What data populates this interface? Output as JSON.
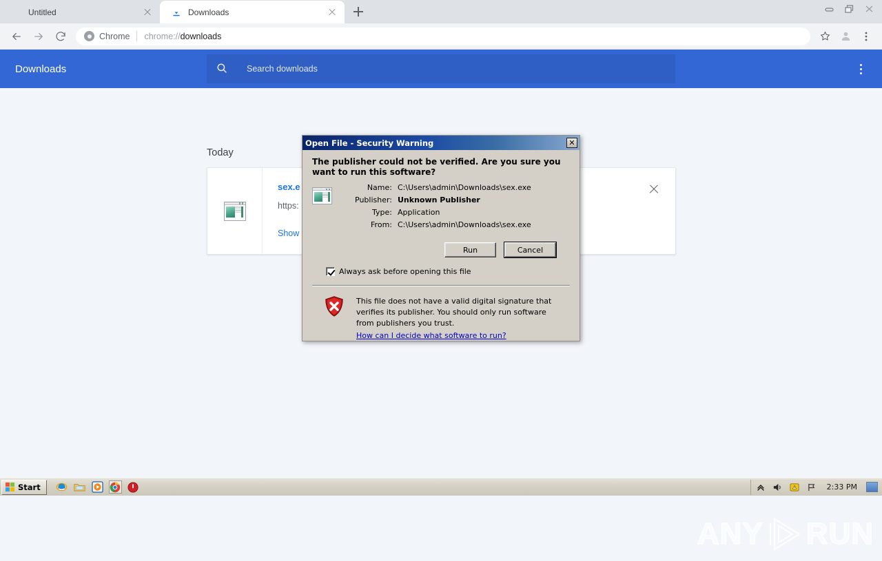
{
  "window_controls": [
    {
      "name": "minimize",
      "glyph": "minimize-icon"
    },
    {
      "name": "restore",
      "glyph": "restore-icon"
    },
    {
      "name": "close",
      "glyph": "close-icon"
    }
  ],
  "tabs": [
    {
      "title": "Untitled",
      "active": false,
      "favicon": "blank-page-icon"
    },
    {
      "title": "Downloads",
      "active": true,
      "favicon": "download-icon"
    }
  ],
  "new_tab_label": "+",
  "toolbar": {
    "back_label": "Back",
    "forward_label": "Forward",
    "reload_label": "Reload",
    "omnibox": {
      "scheme_label": "Chrome",
      "url_prefix": "chrome://",
      "url_main": "downloads",
      "full_url": "chrome://downloads"
    },
    "bookmark_label": "Bookmark this page",
    "profile_label": "Profile",
    "menu_label": "Customize and control Google Chrome"
  },
  "downloads_page": {
    "title": "Downloads",
    "search_placeholder": "Search downloads",
    "menu_label": "More actions",
    "section_label": "Today",
    "item": {
      "filename": "sex.e",
      "url": "https:",
      "action_link": "Show",
      "close_label": "Remove from list",
      "file_icon": "application-window-icon"
    },
    "accent_color": "#3367d6",
    "search_bg_color": "#2f5fc4",
    "link_color": "#1a73e8"
  },
  "dialog": {
    "title": "Open File - Security Warning",
    "close_glyph": "✕",
    "question": "The publisher could not be verified.  Are you sure you want to run this software?",
    "fields": [
      {
        "label": "Name:",
        "value": "C:\\Users\\admin\\Downloads\\sex.exe",
        "bold": false
      },
      {
        "label": "Publisher:",
        "value": "Unknown Publisher",
        "bold": true
      },
      {
        "label": "Type:",
        "value": "Application",
        "bold": false
      },
      {
        "label": "From:",
        "value": "C:\\Users\\admin\\Downloads\\sex.exe",
        "bold": false
      }
    ],
    "buttons": [
      {
        "label": "Run",
        "default": false
      },
      {
        "label": "Cancel",
        "default": true
      }
    ],
    "checkbox_label": "Always ask before opening this file",
    "checkbox_checked": true,
    "footer_text": "This file does not have a valid digital signature that verifies its publisher.  You should only run software from publishers you trust.",
    "footer_link": "How can I decide what software to run?",
    "footer_icon": "red-shield-warning-icon",
    "file_icon": "application-window-icon",
    "titlebar_color": "#0a246a",
    "face_color": "#d4d0c8"
  },
  "watermark": {
    "text_left": "ANY",
    "text_right": "RUN",
    "logo": "play-triangle-icon"
  },
  "taskbar": {
    "start_label": "Start",
    "quick_launch": [
      {
        "name": "internet-explorer-icon",
        "active": false
      },
      {
        "name": "folder-explorer-icon",
        "active": false
      },
      {
        "name": "media-player-icon",
        "active": false
      },
      {
        "name": "google-chrome-icon",
        "active": true
      },
      {
        "name": "red-power-icon",
        "active": false
      }
    ],
    "tray": [
      {
        "name": "show-hidden-icons-chevron-icon"
      },
      {
        "name": "volume-icon"
      },
      {
        "name": "security-alert-icon"
      },
      {
        "name": "network-flag-icon"
      }
    ],
    "clock": "2:33 PM",
    "show_desktop_label": "Show desktop"
  }
}
